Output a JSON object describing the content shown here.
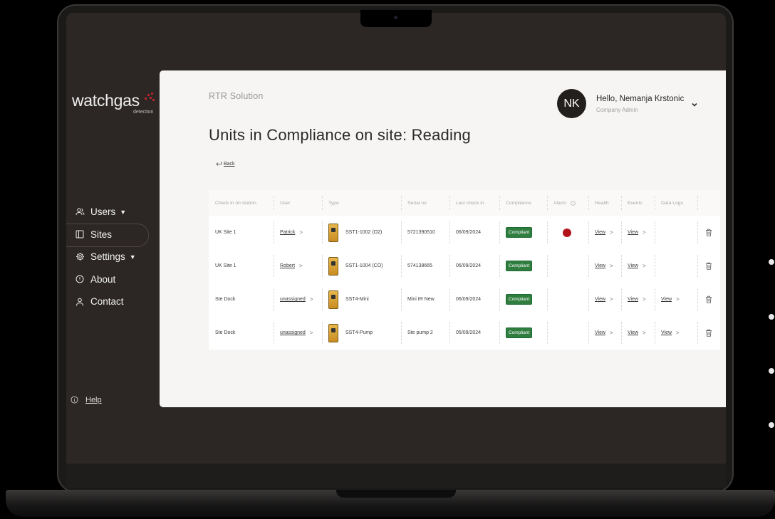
{
  "brand": {
    "name": "watchgas",
    "tagline": "detection",
    "accent": "#d1232a"
  },
  "sidebar": {
    "items": [
      {
        "label": "Users",
        "icon": "users-icon",
        "has_caret": true,
        "active": false
      },
      {
        "label": "Sites",
        "icon": "sites-icon",
        "has_caret": false,
        "active": true
      },
      {
        "label": "Settings",
        "icon": "gear-icon",
        "has_caret": true,
        "active": false
      },
      {
        "label": "About",
        "icon": "info-icon",
        "has_caret": false,
        "active": false
      },
      {
        "label": "Contact",
        "icon": "contact-icon",
        "has_caret": false,
        "active": false
      }
    ],
    "help_label": "Help"
  },
  "header": {
    "breadcrumb": "RTR Solution",
    "title": "Units in Compliance on site: Reading",
    "back_label": "Back"
  },
  "user": {
    "initials": "NK",
    "greeting": "Hello, Nemanja Krstonic",
    "role": "Company Admin"
  },
  "table": {
    "columns": [
      "Check in on station",
      "User",
      "Type",
      "Serial no",
      "Last check in",
      "Compliance",
      "Alarm",
      "Health",
      "Events",
      "Data Logs",
      ""
    ],
    "rows": [
      {
        "station": "UK Site 1",
        "user": "Patrick",
        "type": "SST1-1002 (O2)",
        "serial": "5721390510",
        "last_check": "06/09/2024",
        "compliance": "Compliant",
        "alarm": true,
        "health": "View",
        "events": "View",
        "data_logs": ""
      },
      {
        "station": "UK Site 1",
        "user": "Robert",
        "type": "SST1-1004 (CO)",
        "serial": "574138665",
        "last_check": "06/09/2024",
        "compliance": "Compliant",
        "alarm": false,
        "health": "View",
        "events": "View",
        "data_logs": ""
      },
      {
        "station": "Ste Dock",
        "user": "unassigned",
        "type": "SST4-Mini",
        "serial": "Mini IR New",
        "last_check": "06/09/2024",
        "compliance": "Compliant",
        "alarm": false,
        "health": "View",
        "events": "View",
        "data_logs": "View"
      },
      {
        "station": "Ste Dock",
        "user": "unassigned",
        "type": "SST4-Pump",
        "serial": "Ste pump 2",
        "last_check": "05/09/2024",
        "compliance": "Compliant",
        "alarm": false,
        "health": "View",
        "events": "View",
        "data_logs": "View"
      }
    ]
  },
  "colors": {
    "compliant": "#2f7d3f",
    "alarm": "#b3141c",
    "sidebar_bg": "#2c2725"
  }
}
